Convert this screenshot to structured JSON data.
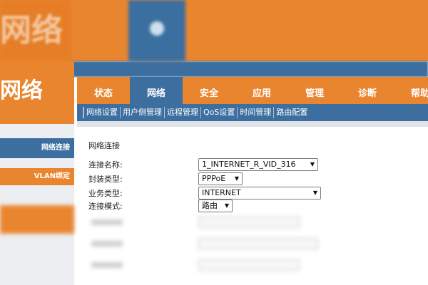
{
  "background": {
    "brand_text": "网络",
    "sidebar": {
      "section_label": "网络",
      "items": [
        {
          "label": "网络连接"
        },
        {
          "label": "VLAN绑定"
        }
      ]
    }
  },
  "tabs": [
    {
      "label": "状态",
      "active": false
    },
    {
      "label": "网络",
      "active": true
    },
    {
      "label": "安全",
      "active": false
    },
    {
      "label": "应用",
      "active": false
    },
    {
      "label": "管理",
      "active": false
    },
    {
      "label": "诊断",
      "active": false
    },
    {
      "label": "帮助",
      "active": false
    }
  ],
  "subnav": [
    {
      "label": "网络设置"
    },
    {
      "label": "用户侧管理"
    },
    {
      "label": "远程管理"
    },
    {
      "label": "QoS设置"
    },
    {
      "label": "时间管理"
    },
    {
      "label": "路由配置"
    }
  ],
  "content": {
    "title": "网络连接",
    "fields": [
      {
        "label": "连接名称:",
        "value": "1_INTERNET_R_VID_316"
      },
      {
        "label": "封装类型:",
        "value": "PPPoE"
      },
      {
        "label": "业务类型:",
        "value": "INTERNET"
      },
      {
        "label": "连接模式:",
        "value": "路由"
      }
    ]
  },
  "colors": {
    "orange": "#e9852f",
    "blue": "#3c6e9f"
  }
}
